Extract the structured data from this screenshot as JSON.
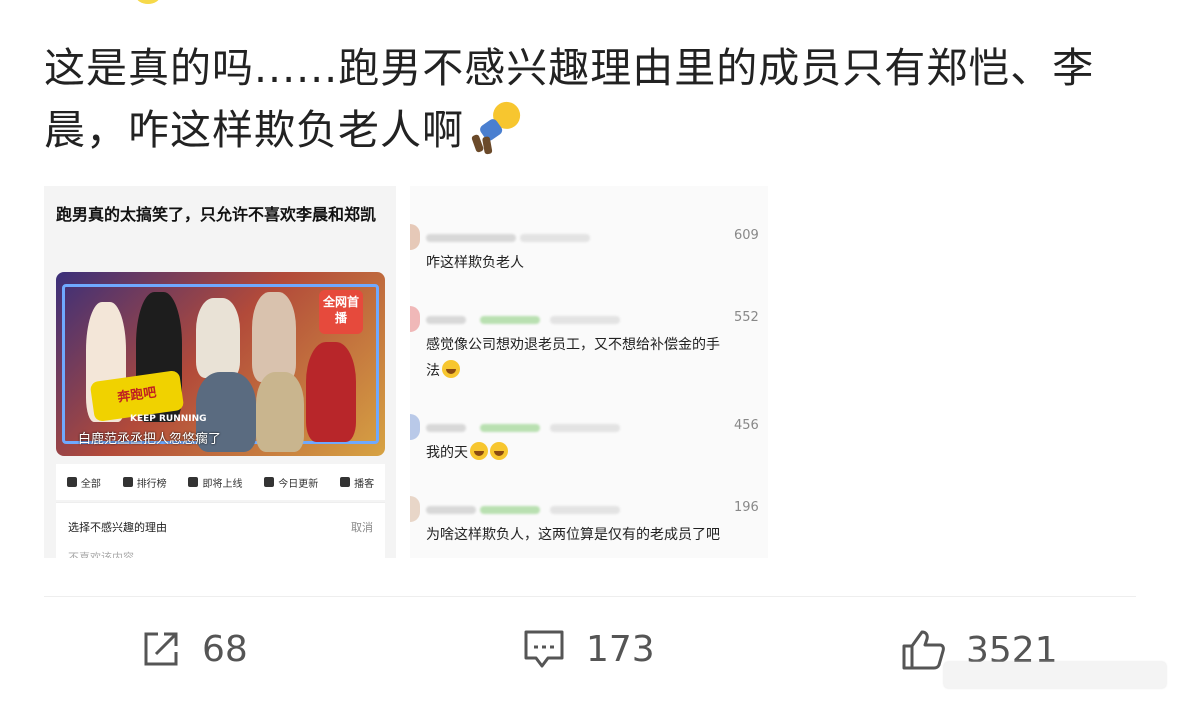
{
  "post": {
    "text": "这是真的吗......跑男不感兴趣理由里的成员只有郑恺、李晨，咋这样欺负老人啊"
  },
  "screenshot_left": {
    "title": "跑男真的太搞笑了，只允许不喜欢李晨和郑凯",
    "badge": "全网首播",
    "logo_text": "奔跑吧",
    "keep_running": "KEEP RUNNING",
    "subtitle": "白鹿范丞丞把人忽悠瘸了",
    "menu": [
      "全部",
      "排行榜",
      "即将上线",
      "今日更新",
      "播客"
    ],
    "sheet_title": "选择不感兴趣的理由",
    "sheet_cancel": "取消",
    "sheet_option": "不喜欢该内容"
  },
  "screenshot_right": {
    "comments": [
      {
        "count": "609",
        "lines": [
          "咋这样欺负老人"
        ]
      },
      {
        "count": "552",
        "lines": [
          "感觉像公司想劝退老员工，又不想给补偿金的手",
          "法"
        ]
      },
      {
        "count": "456",
        "lines": [
          "我的天"
        ]
      },
      {
        "count": "196",
        "lines": [
          "为啥这样欺负人，这两位算是仅有的老成员了吧"
        ]
      }
    ]
  },
  "actions": {
    "repost_count": "68",
    "comment_count": "173",
    "like_count": "3521"
  },
  "icons": {
    "repost": "share-icon",
    "comment": "comment-icon",
    "like": "thumbs-up-icon"
  },
  "colors": {
    "text": "#222222",
    "icon": "#555555",
    "badge": "#e64a3c"
  }
}
